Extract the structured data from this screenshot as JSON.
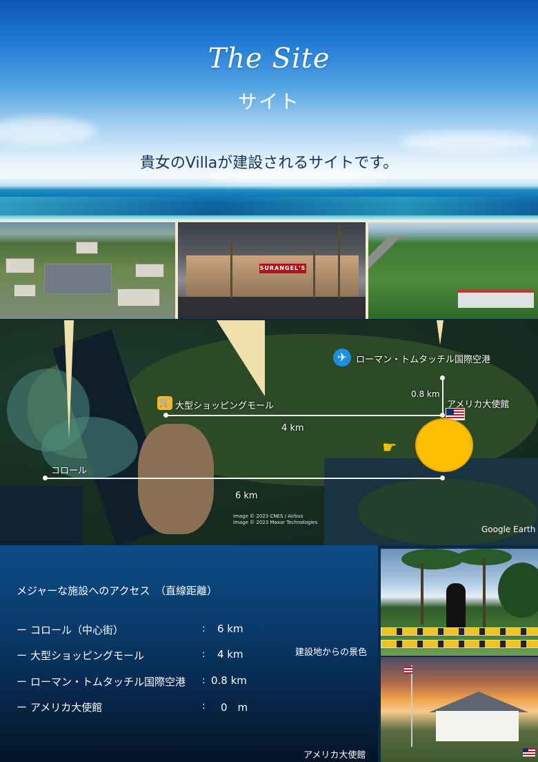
{
  "hero": {
    "title": "The Site",
    "title_jp": "サイト",
    "subtitle": "貴女のVillaが建設されるサイトです。"
  },
  "photos": {
    "mall_sign": "SURANGEL'S"
  },
  "map": {
    "airport_label": "ローマン・トムタッチル国際空港",
    "mall_label": "大型ショッピングモール",
    "koror_label": "コロール",
    "embassy_label": "アメリカ大使館",
    "dist_airport": "0.8 km",
    "dist_mall": "4 km",
    "dist_koror": "6 km",
    "credit_line1": "Image © 2023 CNES / Airbus",
    "credit_line2": "Image © 2023 Maxar Technologies",
    "watermark": "Google Earth",
    "icons": [
      "airplane-icon",
      "shopping-cart-icon",
      "us-flag-icon",
      "pointing-hand-icon"
    ],
    "marker_color": "#fdbf00"
  },
  "access": {
    "title": "メジャーな施設へのアクセス　（直線距離）",
    "rows": [
      {
        "dash": "ー",
        "name": "コロール（中心街）",
        "sep": ":",
        "value": "6 km"
      },
      {
        "dash": "ー",
        "name": "大型ショッピングモール",
        "sep": ":",
        "value": "4 km"
      },
      {
        "dash": "ー",
        "name": "ローマン・トムタッチル国際空港",
        "sep": ":",
        "value": "0.8 km"
      },
      {
        "dash": "ー",
        "name": "アメリカ大使館",
        "sep": ":",
        "value": "0　m"
      }
    ]
  },
  "captions": {
    "view": "建設地からの景色",
    "embassy": "アメリカ大使館"
  }
}
